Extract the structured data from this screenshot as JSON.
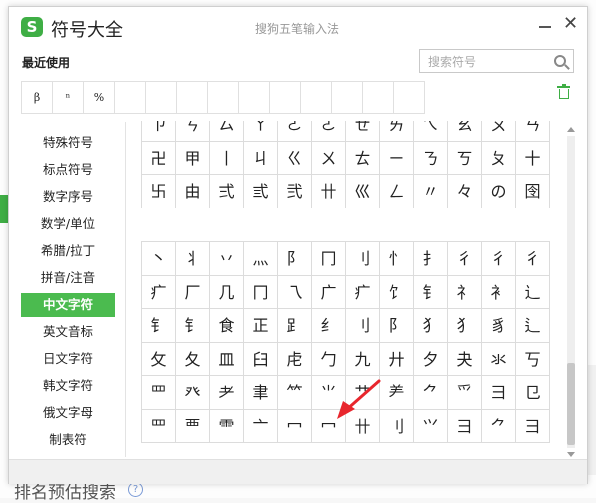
{
  "background": {
    "bottom_text": "排名预估搜索",
    "help_icon": "?"
  },
  "window": {
    "logo_letter": "S",
    "title": "符号大全",
    "subtitle": "搜狗五笔输入法",
    "close_label": "✕"
  },
  "recent": {
    "label": "最近使用",
    "symbols": [
      "β",
      "ⁿ",
      "%",
      "",
      "",
      "",
      "",
      "",
      "",
      "",
      "",
      "",
      ""
    ]
  },
  "search": {
    "placeholder": "搜索符号",
    "value": ""
  },
  "sidebar": {
    "items": [
      {
        "label": "特殊符号"
      },
      {
        "label": "标点符号"
      },
      {
        "label": "数字序号"
      },
      {
        "label": "数学/单位"
      },
      {
        "label": "希腊/拉丁"
      },
      {
        "label": "拼音/注音"
      },
      {
        "label": "中文字符"
      },
      {
        "label": "英文音标"
      },
      {
        "label": "日文字符"
      },
      {
        "label": "韩文字符"
      },
      {
        "label": "俄文字母"
      },
      {
        "label": "制表符"
      }
    ],
    "active_index": 6
  },
  "grid_top": {
    "rows": [
      [
        "ㄗ",
        "ㄘ",
        "ㄙ",
        "ㄚ",
        "ㄛ",
        "ㄜ",
        "ㄝ",
        "ㄞ",
        "ㄟ",
        "ㄠ",
        "ㄡ",
        "ㄢ"
      ],
      [
        "卍",
        "甲",
        "丨",
        "ㄐ",
        "ㄍ",
        "ㄨ",
        "ㄊ",
        "ㄧ",
        "ㄋ",
        "ㄎ",
        "ㄆ",
        "十"
      ],
      [
        "卐",
        "由",
        "弍",
        "弎",
        "弐",
        "卄",
        "巛",
        "ㄥ",
        "〃",
        "々",
        "の",
        "囹"
      ]
    ]
  },
  "grid_bottom": {
    "rows": [
      [
        "丶",
        "丬",
        "丷",
        "灬",
        "阝",
        "冂",
        "刂",
        "忄",
        "扌",
        "彳",
        "彳",
        "彳"
      ],
      [
        "疒",
        "厂",
        "几",
        "冂",
        "乁",
        "广",
        "疒",
        "饣",
        "钅",
        "礻",
        "衤",
        "辶"
      ],
      [
        "钅",
        "钅",
        "食",
        "正",
        "⻊",
        "纟",
        "刂",
        "⻖",
        "犭",
        "犭",
        "豸",
        "⻍"
      ],
      [
        "攵",
        "夂",
        "皿",
        "臼",
        "虍",
        "勹",
        "九",
        "廾",
        "夕",
        "夬",
        "氺",
        "丂"
      ],
      [
        "罒",
        "癶",
        "耂",
        "聿",
        "⺮",
        "⺌",
        "艹",
        "⺶",
        "⺈",
        "⺤",
        "⺕",
        "⺋"
      ],
      [
        "罒",
        "覀",
        "⻗",
        "亠",
        "冖",
        "冖",
        "卄",
        "⺉",
        "⺍",
        "⺕",
        "⺈",
        "⺕"
      ]
    ]
  },
  "colors": {
    "accent": "#4bbb4f",
    "annotation_arrow": "#e8262d"
  }
}
